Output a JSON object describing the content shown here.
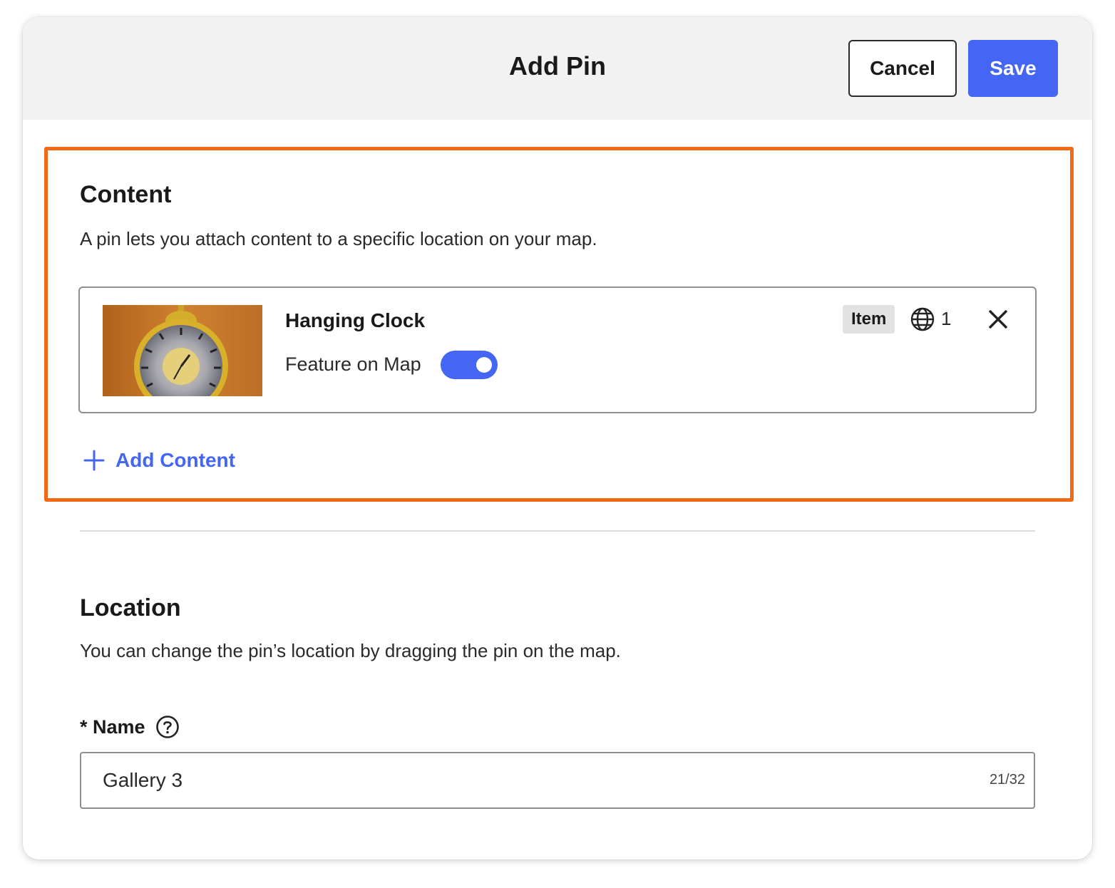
{
  "header": {
    "title": "Add Pin",
    "cancel_label": "Cancel",
    "save_label": "Save"
  },
  "content_section": {
    "title": "Content",
    "description": "A pin lets you attach content to a specific location on your map.",
    "items": [
      {
        "title": "Hanging Clock",
        "feature_label": "Feature on Map",
        "feature_on": true,
        "type_badge": "Item",
        "globe_count": "1"
      }
    ],
    "add_label": "Add Content"
  },
  "location_section": {
    "title": "Location",
    "description": "You can change the pin’s location by dragging the pin on the map.",
    "name_label": "* Name",
    "name_value": "Gallery 3",
    "name_counter": "21/32"
  },
  "colors": {
    "accent": "#4466f2",
    "highlight": "#f26a16"
  },
  "icons": {
    "globe": "globe-icon",
    "close": "close-icon",
    "add": "plus-icon",
    "help": "help-icon"
  }
}
